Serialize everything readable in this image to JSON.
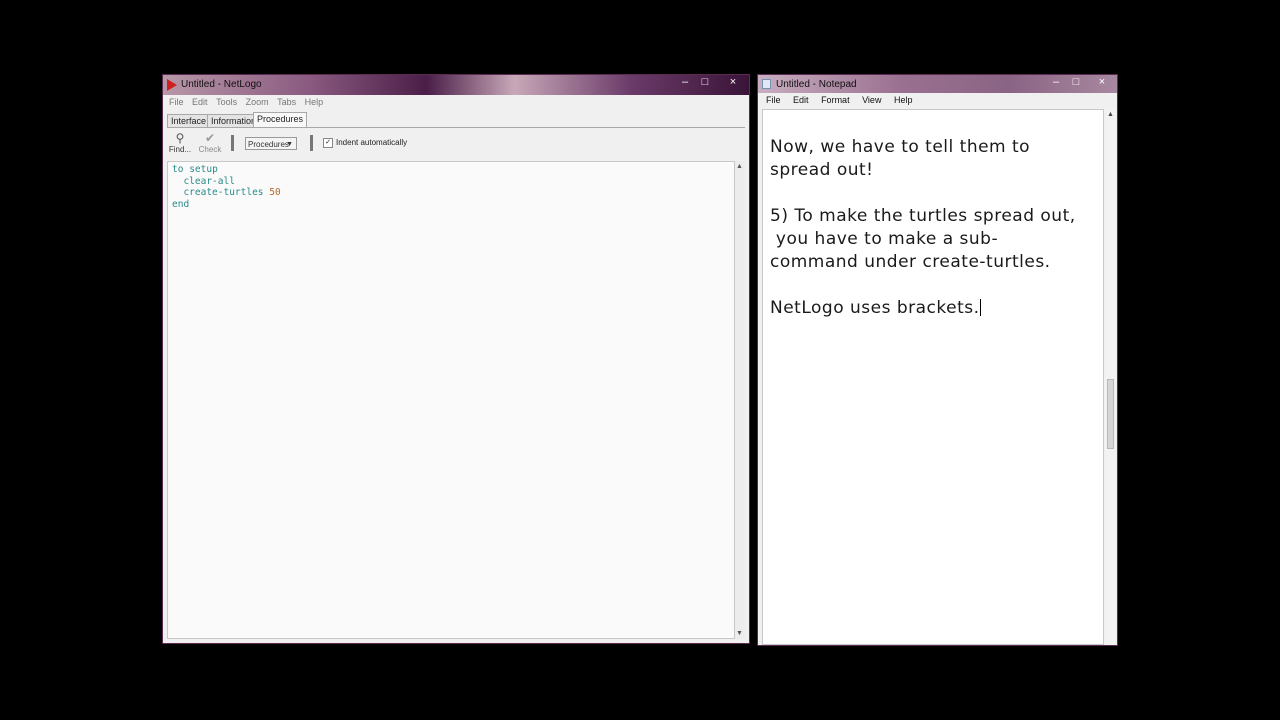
{
  "netlogo": {
    "title": "Untitled - NetLogo",
    "menu": [
      "File",
      "Edit",
      "Tools",
      "Zoom",
      "Tabs",
      "Help"
    ],
    "tabs": [
      "Interface",
      "Information",
      "Procedures"
    ],
    "active_tab": "Procedures",
    "toolbar": {
      "find_label": "Find...",
      "check_label": "Check",
      "procedures_dropdown": "Procedures",
      "indent_label": "Indent automatically",
      "indent_checked": true
    },
    "code": {
      "line1_kw": "to",
      "line1_name": "setup",
      "line2": "clear-all",
      "line3_cmd": "create-turtles",
      "line3_num": "50",
      "line4": "end"
    }
  },
  "notepad": {
    "title": "Untitled - Notepad",
    "menu": [
      "File",
      "Edit",
      "Format",
      "View",
      "Help"
    ],
    "lines": [
      "Now, we have to tell them to",
      "spread out!",
      "",
      "5) To make the turtles spread out,",
      " you have to make a sub-",
      "command under create-turtles.",
      "",
      "NetLogo uses brackets."
    ]
  },
  "icons": {
    "netlogo_app": "netlogo-app-icon",
    "notepad_app": "notepad-app-icon",
    "find": "find-icon",
    "check": "checkmark-icon"
  }
}
